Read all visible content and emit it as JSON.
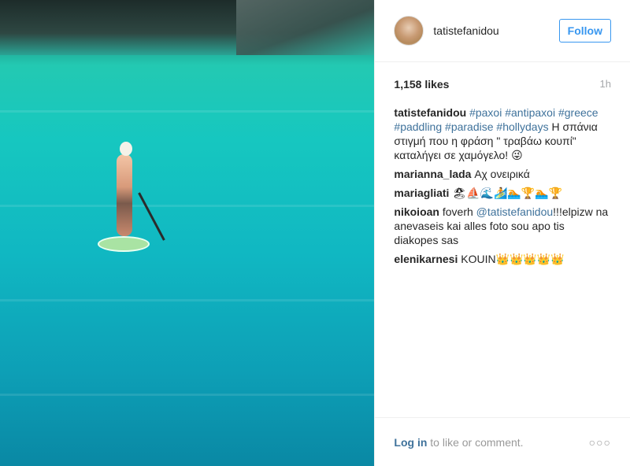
{
  "post": {
    "author": "tatistefanidou",
    "follow_label": "Follow",
    "likes": "1,158 likes",
    "time": "1h"
  },
  "caption": {
    "author": "tatistefanidou",
    "hashtags": [
      "#paxoi",
      "#antipaxoi",
      "#greece",
      "#paddling",
      "#paradise",
      "#hollydays"
    ],
    "text": "Η σπάνια στιγμή που η φράση \" τραβάω κουπί\" καταλήγει σε χαμόγελο! 😜"
  },
  "comments": [
    {
      "author": "marianna_lada",
      "text": "Αχ ονειρικά"
    },
    {
      "author": "mariagliati",
      "text": "🏖⛵🌊🏄🏊🏆🏊🏆"
    },
    {
      "author": "nikoioan",
      "pre": "foverh ",
      "mention": "@tatistefanidou",
      "post": "!!!elpizw na anevaseis kai alles foto sou apo tis diakopes sas"
    },
    {
      "author": "elenikarnesi",
      "text": "KOUIN👑👑👑👑👑"
    }
  ],
  "footer": {
    "login_label": "Log in",
    "login_suffix": " to like or comment.",
    "more_icon": "ellipsis-icon"
  },
  "colors": {
    "link_blue": "#3f729b",
    "follow_blue": "#3897f0"
  }
}
